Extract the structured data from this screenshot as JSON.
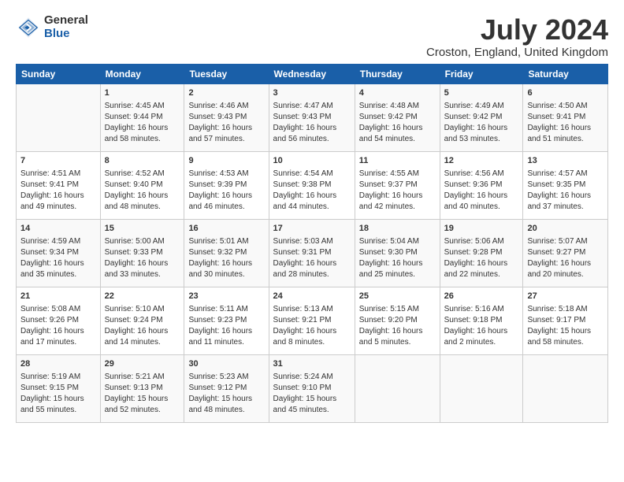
{
  "logo": {
    "general": "General",
    "blue": "Blue"
  },
  "title": "July 2024",
  "location": "Croston, England, United Kingdom",
  "days_of_week": [
    "Sunday",
    "Monday",
    "Tuesday",
    "Wednesday",
    "Thursday",
    "Friday",
    "Saturday"
  ],
  "weeks": [
    [
      {
        "day": "",
        "content": ""
      },
      {
        "day": "1",
        "content": "Sunrise: 4:45 AM\nSunset: 9:44 PM\nDaylight: 16 hours\nand 58 minutes."
      },
      {
        "day": "2",
        "content": "Sunrise: 4:46 AM\nSunset: 9:43 PM\nDaylight: 16 hours\nand 57 minutes."
      },
      {
        "day": "3",
        "content": "Sunrise: 4:47 AM\nSunset: 9:43 PM\nDaylight: 16 hours\nand 56 minutes."
      },
      {
        "day": "4",
        "content": "Sunrise: 4:48 AM\nSunset: 9:42 PM\nDaylight: 16 hours\nand 54 minutes."
      },
      {
        "day": "5",
        "content": "Sunrise: 4:49 AM\nSunset: 9:42 PM\nDaylight: 16 hours\nand 53 minutes."
      },
      {
        "day": "6",
        "content": "Sunrise: 4:50 AM\nSunset: 9:41 PM\nDaylight: 16 hours\nand 51 minutes."
      }
    ],
    [
      {
        "day": "7",
        "content": "Sunrise: 4:51 AM\nSunset: 9:41 PM\nDaylight: 16 hours\nand 49 minutes."
      },
      {
        "day": "8",
        "content": "Sunrise: 4:52 AM\nSunset: 9:40 PM\nDaylight: 16 hours\nand 48 minutes."
      },
      {
        "day": "9",
        "content": "Sunrise: 4:53 AM\nSunset: 9:39 PM\nDaylight: 16 hours\nand 46 minutes."
      },
      {
        "day": "10",
        "content": "Sunrise: 4:54 AM\nSunset: 9:38 PM\nDaylight: 16 hours\nand 44 minutes."
      },
      {
        "day": "11",
        "content": "Sunrise: 4:55 AM\nSunset: 9:37 PM\nDaylight: 16 hours\nand 42 minutes."
      },
      {
        "day": "12",
        "content": "Sunrise: 4:56 AM\nSunset: 9:36 PM\nDaylight: 16 hours\nand 40 minutes."
      },
      {
        "day": "13",
        "content": "Sunrise: 4:57 AM\nSunset: 9:35 PM\nDaylight: 16 hours\nand 37 minutes."
      }
    ],
    [
      {
        "day": "14",
        "content": "Sunrise: 4:59 AM\nSunset: 9:34 PM\nDaylight: 16 hours\nand 35 minutes."
      },
      {
        "day": "15",
        "content": "Sunrise: 5:00 AM\nSunset: 9:33 PM\nDaylight: 16 hours\nand 33 minutes."
      },
      {
        "day": "16",
        "content": "Sunrise: 5:01 AM\nSunset: 9:32 PM\nDaylight: 16 hours\nand 30 minutes."
      },
      {
        "day": "17",
        "content": "Sunrise: 5:03 AM\nSunset: 9:31 PM\nDaylight: 16 hours\nand 28 minutes."
      },
      {
        "day": "18",
        "content": "Sunrise: 5:04 AM\nSunset: 9:30 PM\nDaylight: 16 hours\nand 25 minutes."
      },
      {
        "day": "19",
        "content": "Sunrise: 5:06 AM\nSunset: 9:28 PM\nDaylight: 16 hours\nand 22 minutes."
      },
      {
        "day": "20",
        "content": "Sunrise: 5:07 AM\nSunset: 9:27 PM\nDaylight: 16 hours\nand 20 minutes."
      }
    ],
    [
      {
        "day": "21",
        "content": "Sunrise: 5:08 AM\nSunset: 9:26 PM\nDaylight: 16 hours\nand 17 minutes."
      },
      {
        "day": "22",
        "content": "Sunrise: 5:10 AM\nSunset: 9:24 PM\nDaylight: 16 hours\nand 14 minutes."
      },
      {
        "day": "23",
        "content": "Sunrise: 5:11 AM\nSunset: 9:23 PM\nDaylight: 16 hours\nand 11 minutes."
      },
      {
        "day": "24",
        "content": "Sunrise: 5:13 AM\nSunset: 9:21 PM\nDaylight: 16 hours\nand 8 minutes."
      },
      {
        "day": "25",
        "content": "Sunrise: 5:15 AM\nSunset: 9:20 PM\nDaylight: 16 hours\nand 5 minutes."
      },
      {
        "day": "26",
        "content": "Sunrise: 5:16 AM\nSunset: 9:18 PM\nDaylight: 16 hours\nand 2 minutes."
      },
      {
        "day": "27",
        "content": "Sunrise: 5:18 AM\nSunset: 9:17 PM\nDaylight: 15 hours\nand 58 minutes."
      }
    ],
    [
      {
        "day": "28",
        "content": "Sunrise: 5:19 AM\nSunset: 9:15 PM\nDaylight: 15 hours\nand 55 minutes."
      },
      {
        "day": "29",
        "content": "Sunrise: 5:21 AM\nSunset: 9:13 PM\nDaylight: 15 hours\nand 52 minutes."
      },
      {
        "day": "30",
        "content": "Sunrise: 5:23 AM\nSunset: 9:12 PM\nDaylight: 15 hours\nand 48 minutes."
      },
      {
        "day": "31",
        "content": "Sunrise: 5:24 AM\nSunset: 9:10 PM\nDaylight: 15 hours\nand 45 minutes."
      },
      {
        "day": "",
        "content": ""
      },
      {
        "day": "",
        "content": ""
      },
      {
        "day": "",
        "content": ""
      }
    ]
  ]
}
